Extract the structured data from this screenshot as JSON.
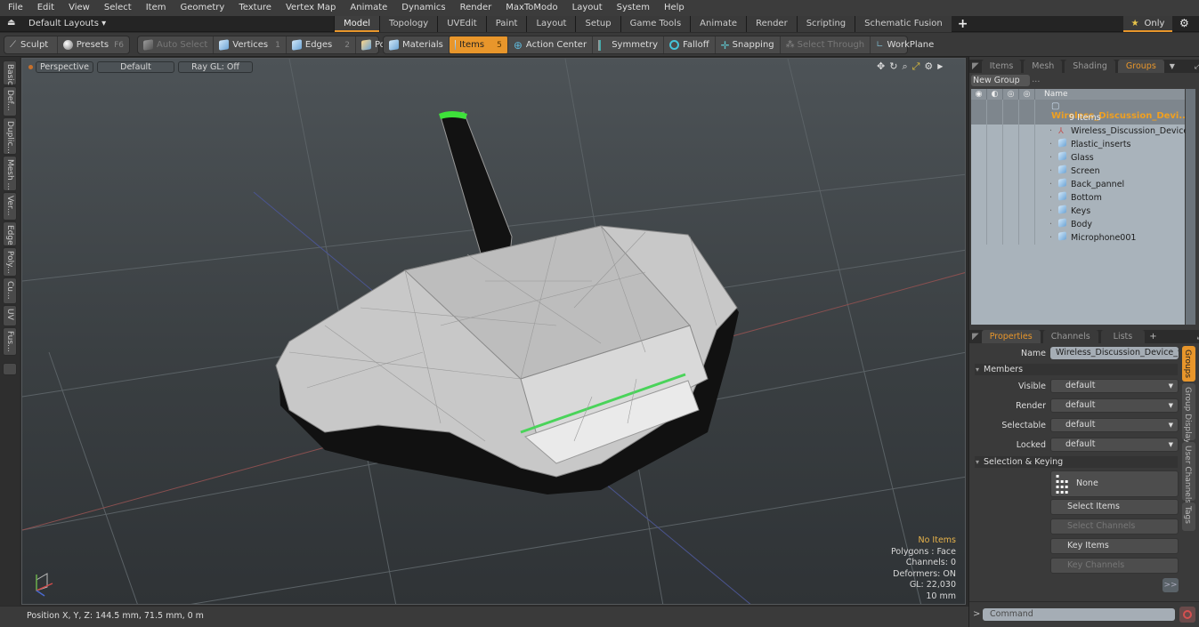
{
  "menu": [
    "File",
    "Edit",
    "View",
    "Select",
    "Item",
    "Geometry",
    "Texture",
    "Vertex Map",
    "Animate",
    "Dynamics",
    "Render",
    "MaxToModo",
    "Layout",
    "System",
    "Help"
  ],
  "layout_bar": {
    "layout_label": "Default Layouts ▾",
    "tabs": [
      "Model",
      "Topology",
      "UVEdit",
      "Paint",
      "Layout",
      "Setup",
      "Game Tools",
      "Animate",
      "Render",
      "Scripting",
      "Schematic Fusion"
    ],
    "active_tab": "Model",
    "add_tab": "+",
    "only_label": "Only"
  },
  "toolbar": {
    "sculpt": "Sculpt",
    "presets": "Presets",
    "presets_hotkey": "F6",
    "auto_select": "Auto Select",
    "vertices": "Vertices",
    "vertices_hotkey": "1",
    "edges": "Edges",
    "edges_hotkey": "2",
    "polygons": "Polygons",
    "materials": "Materials",
    "items": "Items",
    "items_hotkey": "5",
    "action_center": "Action Center",
    "symmetry": "Symmetry",
    "falloff": "Falloff",
    "snapping": "Snapping",
    "select_through": "Select Through",
    "workplane": "WorkPlane"
  },
  "left_tabs": [
    "Basic",
    "Def...",
    "Duplic...",
    "Mesh ...",
    "Ver...",
    "Edge",
    "Poly...",
    "Cu...",
    "UV",
    "Fus..."
  ],
  "viewport": {
    "view_mode": "Perspective",
    "shading": "Default",
    "raygl": "Ray GL: Off",
    "info": {
      "selection": "No Items",
      "polygons": "Polygons : Face",
      "channels": "Channels: 0",
      "deformers": "Deformers: ON",
      "gl": "GL: 22,030",
      "scale": "10 mm"
    }
  },
  "status": {
    "position": "Position X, Y, Z:   144.5 mm, 71.5 mm, 0 m"
  },
  "groups_panel": {
    "tabs": [
      "Items",
      "Mesh ...",
      "Shading",
      "Groups"
    ],
    "active_tab": "Groups",
    "new_group": "New Group",
    "name_header": "Name",
    "group_name": "Wireless_Discussion_Devi...",
    "group_count": "9 Items",
    "children": [
      "Wireless_Discussion_Device ...",
      "Plastic_inserts",
      "Glass",
      "Screen",
      "Back_pannel",
      "Bottom",
      "Keys",
      "Body",
      "Microphone001"
    ]
  },
  "properties_panel": {
    "tabs": [
      "Properties",
      "Channels",
      "Lists"
    ],
    "active_tab": "Properties",
    "add_tab": "+",
    "name_label": "Name",
    "name_value": "Wireless_Discussion_Device_with",
    "members_section": "Members",
    "fields": [
      {
        "label": "Visible",
        "value": "default"
      },
      {
        "label": "Render",
        "value": "default"
      },
      {
        "label": "Selectable",
        "value": "default"
      },
      {
        "label": "Locked",
        "value": "default"
      }
    ],
    "selection_section": "Selection & Keying",
    "none_label": "None",
    "select_items": "Select Items",
    "select_channels": "Select Channels",
    "key_items": "Key Items",
    "key_channels": "Key Channels",
    "more": ">>",
    "side_tabs": [
      "Groups",
      "Group Display",
      "User Channels",
      "Tags"
    ],
    "command_placeholder": "Command",
    "command_prompt": ">"
  }
}
